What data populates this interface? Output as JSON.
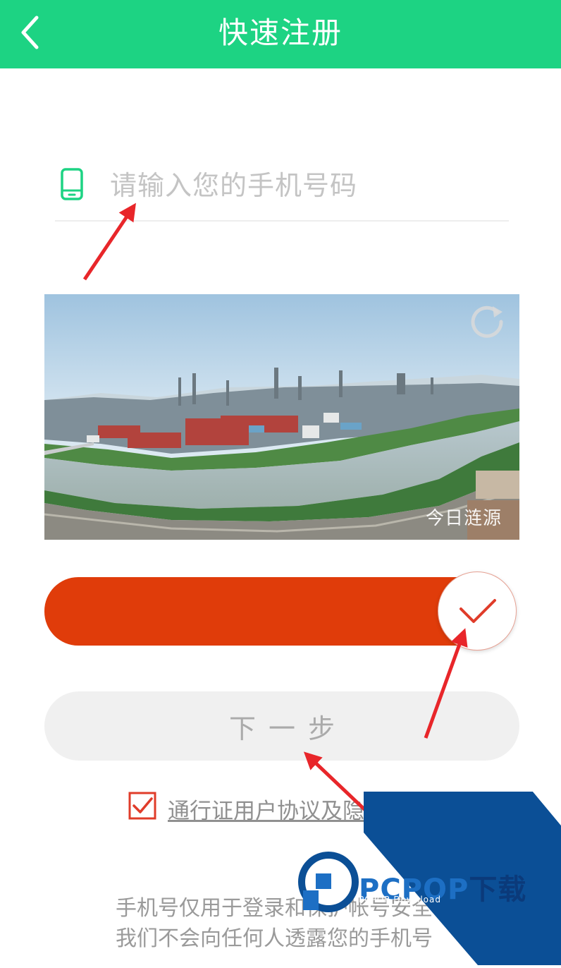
{
  "header": {
    "title": "快速注册",
    "back_icon": "chevron-left-icon",
    "color": "#1dd383"
  },
  "phone": {
    "icon": "mobile-phone-icon",
    "placeholder": "请输入您的手机号码",
    "value": ""
  },
  "captcha": {
    "image": "industrial-riverside-panorama",
    "watermark": "今日涟源",
    "refresh_icon": "refresh-icon"
  },
  "slider": {
    "track_color": "#e03c0a",
    "knob_icon": "checkmark-icon",
    "progress": 1.0
  },
  "next_button": {
    "label": "下一步"
  },
  "agreement": {
    "checked": true,
    "link_text": "通行证用户协议及隐私"
  },
  "notes": [
    "手机号仅用于登录和保护帐号安全",
    "我们不会向任何人透露您的手机号"
  ],
  "site_watermark": {
    "name_a": "PCPOP",
    "name_b": "下载",
    "sub": "PCPOP Download",
    "color": "#0b4f96"
  }
}
